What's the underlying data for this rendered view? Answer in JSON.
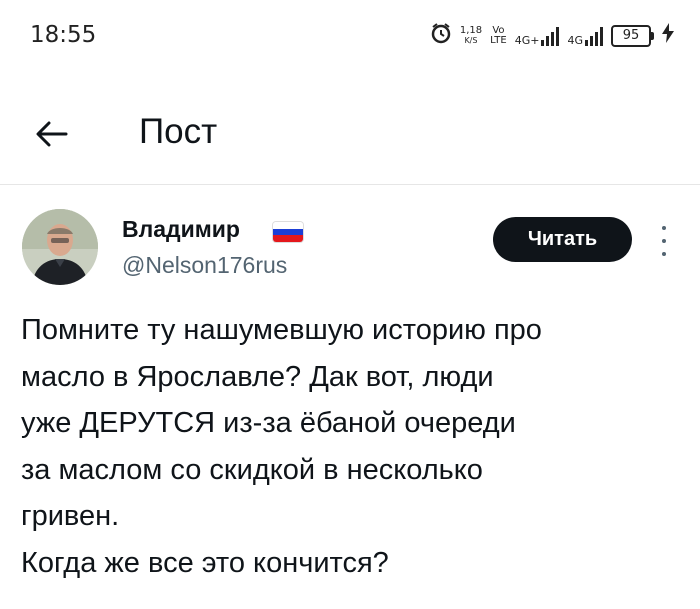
{
  "status_bar": {
    "time": "18:55",
    "speed_value": "1,18",
    "speed_unit": "K/S",
    "volte_top": "Vo",
    "volte_bottom": "LTE",
    "net1": "4G+",
    "net2": "4G",
    "battery": "95"
  },
  "header": {
    "title": "Пост"
  },
  "author": {
    "name": "Владимир",
    "handle": "@Nelson176rus",
    "flag_colors": [
      "#ffffff",
      "#1c3fd6",
      "#e4181c"
    ]
  },
  "follow_button": {
    "label": "Читать"
  },
  "post": {
    "text": "Помните ту нашумевшую историю про\nмасло в Ярославле? Дак вот, люди\nуже ДЕРУТСЯ из-за ёбаной очереди\nза маслом со скидкой в несколько\nгривен.\nКогда же все это кончится?"
  },
  "colors": {
    "text_primary": "#0f1419",
    "text_secondary": "#536471",
    "button_bg": "#0f1419"
  }
}
